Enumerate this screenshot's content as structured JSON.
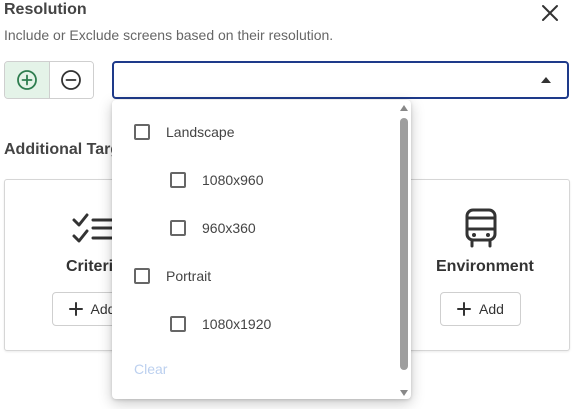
{
  "dialog": {
    "title": "Resolution",
    "subtitle": "Include or Exclude screens based on their resolution."
  },
  "mode": {
    "include_icon": "plus-circle-icon",
    "exclude_icon": "minus-circle-icon",
    "selected": "include"
  },
  "select": {
    "value": ""
  },
  "additional": {
    "title": "Additional Targ",
    "cards": [
      {
        "label": "Criteri",
        "icon": "checklist-icon",
        "add_label": "Add"
      },
      {
        "label": "Environment",
        "icon": "bus-icon",
        "add_label": "Add"
      }
    ]
  },
  "dropdown": {
    "options": [
      {
        "label": "Landscape",
        "level": 0,
        "checked": false
      },
      {
        "label": "1080x960",
        "level": 1,
        "checked": false
      },
      {
        "label": "960x360",
        "level": 1,
        "checked": false
      },
      {
        "label": "Portrait",
        "level": 0,
        "checked": false
      },
      {
        "label": "1080x1920",
        "level": 1,
        "checked": false
      }
    ],
    "clear_label": "Clear"
  },
  "colors": {
    "accent": "#1e3a8a",
    "include_bg": "#e4f3e8",
    "include_icon": "#2e7d4f",
    "clear": "#bcd0ef"
  }
}
